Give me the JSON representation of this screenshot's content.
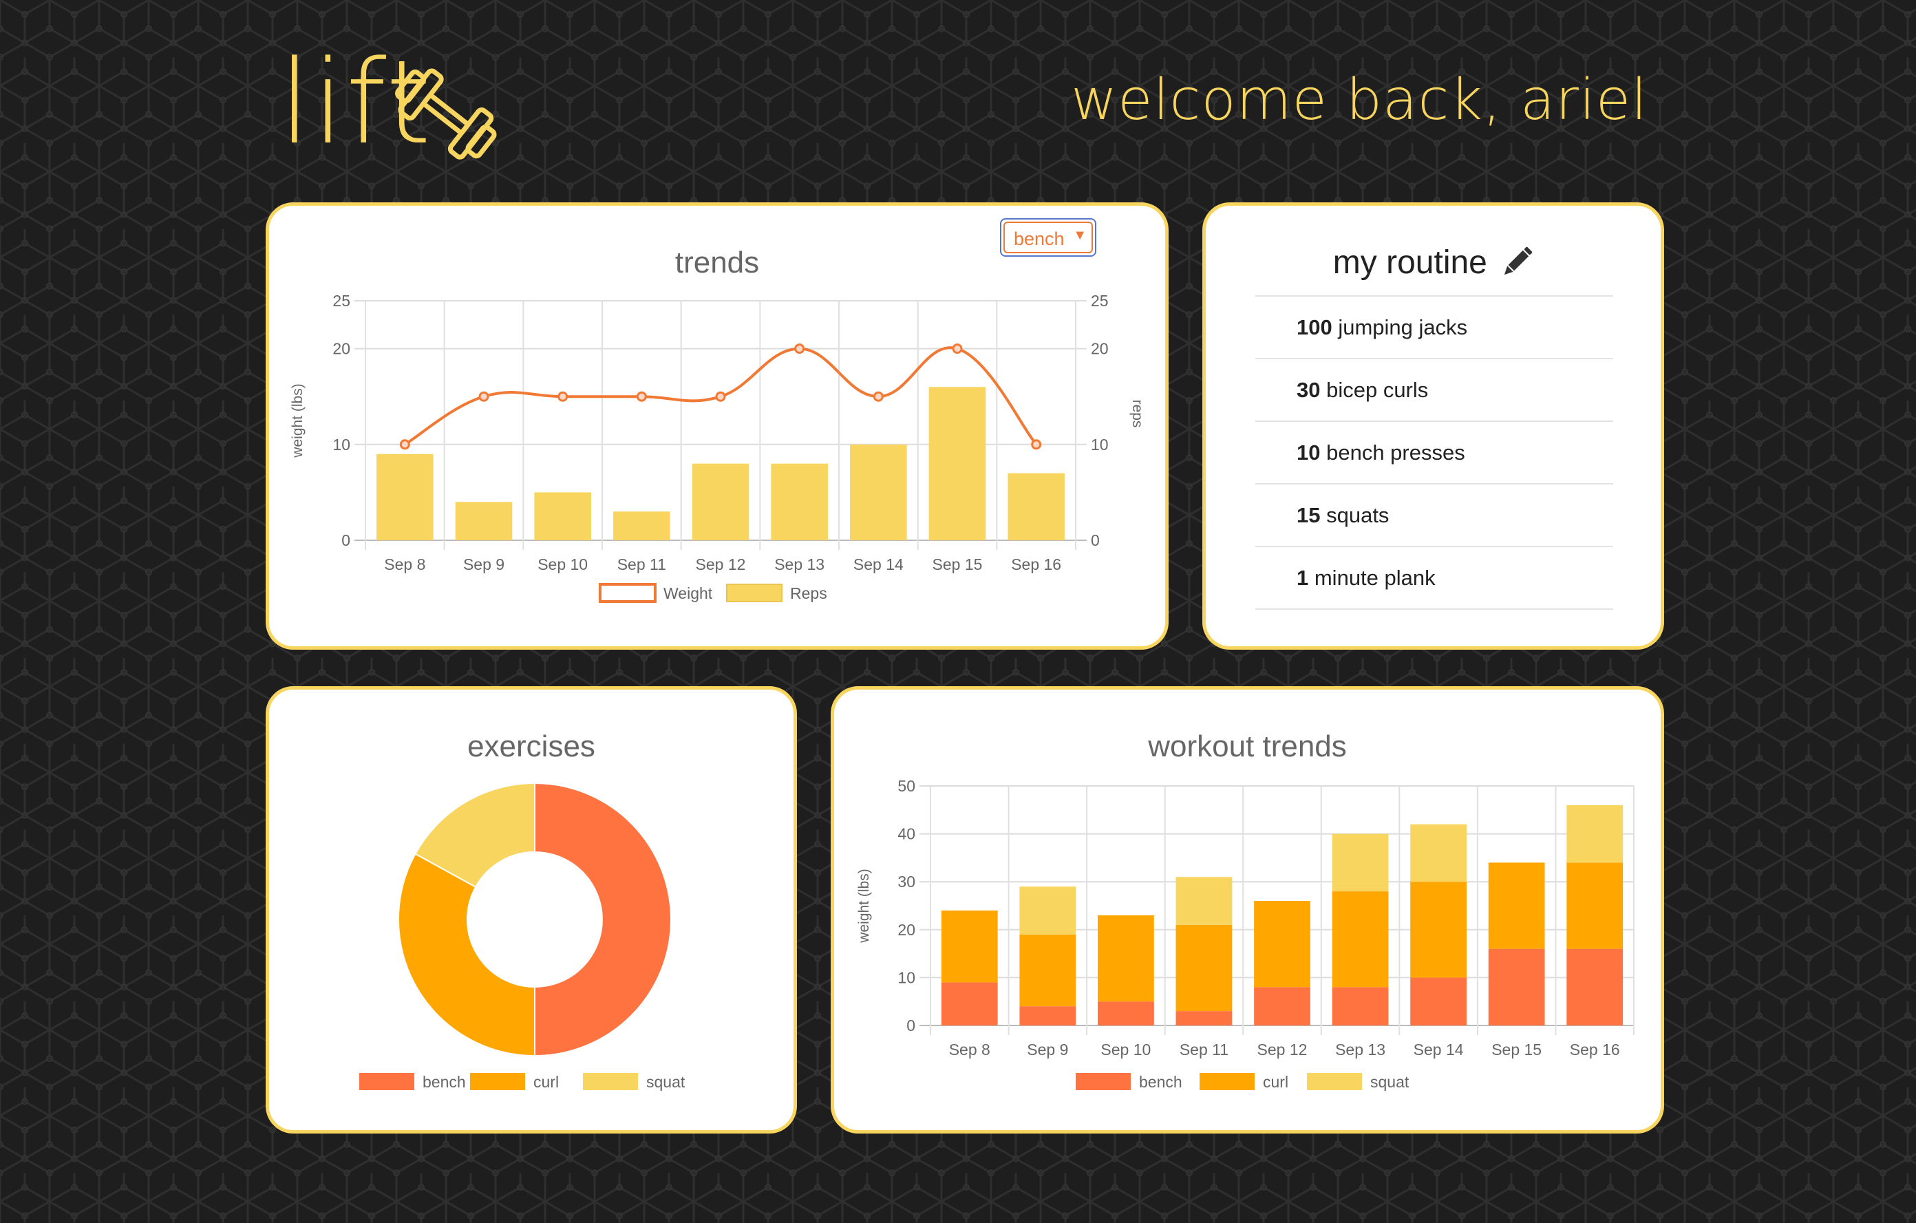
{
  "header": {
    "logo_text": "lift",
    "welcome": "welcome back, ariel"
  },
  "colors": {
    "accent": "#f7d55e",
    "orange": "#f07a35",
    "bench": "#ff7340",
    "curl": "#ffa600",
    "squat": "#f7d55e",
    "background": "#1e1e1e"
  },
  "icons": {
    "logo": "dumbbell-icon",
    "edit": "pencil-icon",
    "dropdown": "caret-down-icon"
  },
  "trends": {
    "title": "trends",
    "dropdown": {
      "selected": "bench"
    }
  },
  "routine": {
    "title": "my routine",
    "items": [
      {
        "count": "100",
        "label": " jumping jacks"
      },
      {
        "count": "30",
        "label": " bicep curls"
      },
      {
        "count": "10",
        "label": " bench presses"
      },
      {
        "count": "15",
        "label": " squats"
      },
      {
        "count": "1",
        "label": " minute plank"
      }
    ]
  },
  "exercises": {
    "title": "exercises"
  },
  "workout_trends": {
    "title": "workout trends"
  },
  "chart_data": [
    {
      "id": "trends",
      "type": "bar+line",
      "title": "trends",
      "categories": [
        "Sep 8",
        "Sep 9",
        "Sep 10",
        "Sep 11",
        "Sep 12",
        "Sep 13",
        "Sep 14",
        "Sep 15",
        "Sep 16"
      ],
      "series": [
        {
          "name": "Weight",
          "type": "line",
          "axis": "left",
          "values": [
            10,
            15,
            15,
            15,
            15,
            20,
            15,
            20,
            10
          ]
        },
        {
          "name": "Reps",
          "type": "bar",
          "axis": "right",
          "values": [
            9,
            4,
            5,
            3,
            8,
            8,
            10,
            16,
            7
          ]
        }
      ],
      "ylabel": "weight (lbs)",
      "y2label": "reps",
      "ylim": [
        0,
        25
      ],
      "y2lim": [
        0,
        25
      ],
      "yticks": [
        0,
        10,
        20,
        25
      ],
      "grid": true,
      "legend": "bottom"
    },
    {
      "id": "exercises",
      "type": "pie",
      "title": "exercises",
      "donut": true,
      "categories": [
        "bench",
        "curl",
        "squat"
      ],
      "values": [
        50,
        33,
        17
      ],
      "legend": "bottom"
    },
    {
      "id": "workout_trends",
      "type": "bar",
      "stacked": true,
      "title": "workout trends",
      "categories": [
        "Sep 8",
        "Sep 9",
        "Sep 10",
        "Sep 11",
        "Sep 12",
        "Sep 13",
        "Sep 14",
        "Sep 15",
        "Sep 16"
      ],
      "series": [
        {
          "name": "bench",
          "values": [
            9,
            4,
            5,
            3,
            8,
            8,
            10,
            16,
            16
          ]
        },
        {
          "name": "curl",
          "values": [
            15,
            15,
            18,
            18,
            18,
            20,
            20,
            18,
            18
          ]
        },
        {
          "name": "squat",
          "values": [
            0,
            10,
            0,
            10,
            0,
            12,
            12,
            0,
            12
          ]
        }
      ],
      "ylabel": "weight (lbs)",
      "ylim": [
        0,
        50
      ],
      "yticks": [
        0,
        10,
        20,
        30,
        40,
        50
      ],
      "grid": true,
      "legend": "bottom"
    }
  ]
}
